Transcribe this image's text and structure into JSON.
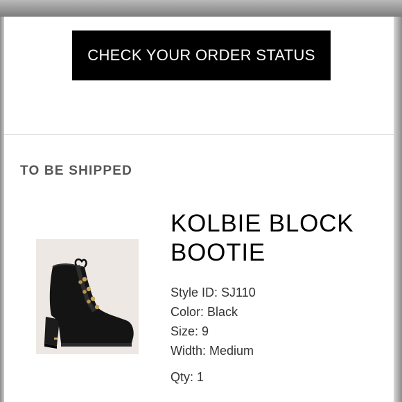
{
  "order": {
    "check_status_label": "CHECK YOUR ORDER STATUS",
    "section_title": "TO BE SHIPPED"
  },
  "product": {
    "name_line1": "KOLBIE BLOCK",
    "name_line2": "BOOTIE",
    "image_icon": "black-lace-up-block-heel-bootie",
    "style": "Style ID: SJ110",
    "color": "Color: Black",
    "size": "Size: 9",
    "width": "Width: Medium",
    "qty": "Qty: 1"
  },
  "colors": {
    "button_bg": "#000000",
    "button_text": "#ffffff",
    "section_title": "#555555",
    "image_bg": "#ede8e3"
  }
}
